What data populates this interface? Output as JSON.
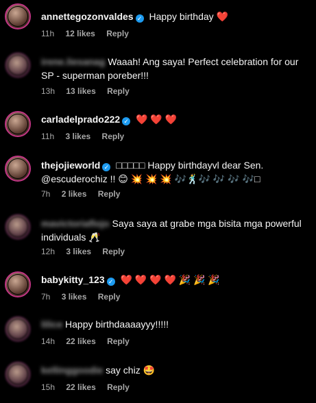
{
  "comments": [
    {
      "username": "annettegozonvaldes",
      "verified": true,
      "text": "Happy birthday ❤️",
      "time": "11h",
      "likes": "12 likes",
      "reply": "Reply"
    },
    {
      "username": "irene.liesanag",
      "verified": false,
      "text": "Waaah! Ang saya! Perfect celebration for our SP - superman poreber!!!",
      "time": "13h",
      "likes": "13 likes",
      "reply": "Reply"
    },
    {
      "username": "carladelprado222",
      "verified": true,
      "text": "❤️ ❤️ ❤️",
      "time": "11h",
      "likes": "3 likes",
      "reply": "Reply"
    },
    {
      "username": "thejojieworld",
      "verified": true,
      "text": "□□□□□ Happy birthdayvl dear Sen. @escuderochiz !! 😊 💥 💥 💥 🎶🕺🎶 🎶 🎶 🎶□",
      "time": "7h",
      "likes": "2 likes",
      "reply": "Reply"
    },
    {
      "username": "mavictoriaflojo",
      "verified": false,
      "text": "Saya saya at grabe mga bisita mga powerful individuals 🥂",
      "time": "12h",
      "likes": "3 likes",
      "reply": "Reply"
    },
    {
      "username": "babykitty_123",
      "verified": true,
      "text": "❤️ ❤️ ❤️ ❤️ 🎉 🎉 🎉",
      "time": "7h",
      "likes": "3 likes",
      "reply": "Reply"
    },
    {
      "username": "lilice",
      "verified": false,
      "text": "Happy birthdaaaayyy!!!!!",
      "time": "14h",
      "likes": "22 likes",
      "reply": "Reply"
    },
    {
      "username": "kellinggoodie",
      "verified": false,
      "text": "say chiz 🤩",
      "time": "15h",
      "likes": "22 likes",
      "reply": "Reply"
    }
  ]
}
